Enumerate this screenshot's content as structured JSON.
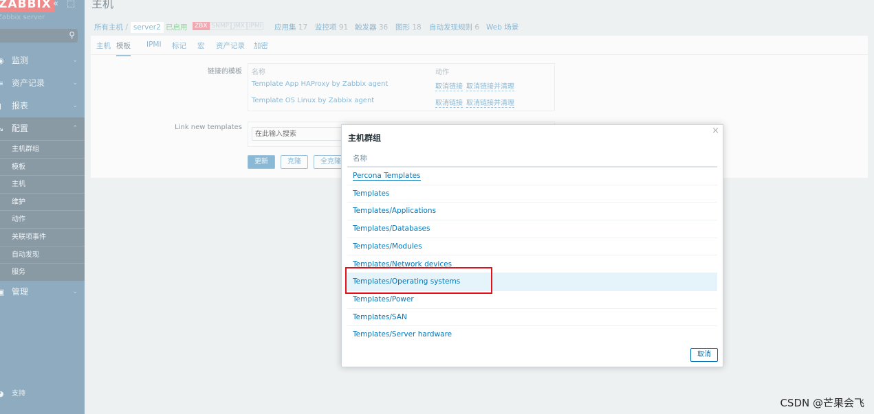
{
  "sidebar": {
    "logo": "ZABBIX",
    "server": "Zabbix server",
    "menu": [
      {
        "label": "监测",
        "icon": "eye-icon"
      },
      {
        "label": "资产记录",
        "icon": "list-icon"
      },
      {
        "label": "报表",
        "icon": "chart-icon"
      },
      {
        "label": "配置",
        "icon": "wrench-icon"
      },
      {
        "label": "管理",
        "icon": "admin-icon"
      }
    ],
    "submenu": [
      "主机群组",
      "模板",
      "主机",
      "维护",
      "动作",
      "关联项事件",
      "自动发现",
      "服务"
    ],
    "support": "支持"
  },
  "header": {
    "title": "主机"
  },
  "nav": {
    "all_hosts": "所有主机",
    "sep": "/",
    "host": "server2",
    "enabled": "已启用",
    "tags": [
      "ZBX",
      "SNMP",
      "JMX",
      "IPMI"
    ],
    "links": [
      {
        "label": "应用集",
        "count": "17"
      },
      {
        "label": "监控项",
        "count": "91"
      },
      {
        "label": "触发器",
        "count": "36"
      },
      {
        "label": "图形",
        "count": "18"
      },
      {
        "label": "自动发现规则",
        "count": "6"
      },
      {
        "label": "Web 场景",
        "count": ""
      }
    ]
  },
  "tabs": [
    "主机",
    "模板",
    "IPMI",
    "标记",
    "宏",
    "资产记录",
    "加密"
  ],
  "form": {
    "linked_label": "链接的模板",
    "col_name": "名称",
    "col_action": "动作",
    "linked": [
      {
        "name": "Template App HAProxy by Zabbix agent",
        "unlink": "取消链接",
        "unlink_clear": "取消链接并清理"
      },
      {
        "name": "Template OS Linux by Zabbix agent",
        "unlink": "取消链接",
        "unlink_clear": "取消链接并清理"
      }
    ],
    "link_new_label": "Link new templates",
    "search_placeholder": "在此输入搜索",
    "buttons": {
      "update": "更新",
      "clone": "克隆",
      "full_clone": "全克隆"
    }
  },
  "dialog": {
    "title": "主机群组",
    "col": "名称",
    "close": "×",
    "cancel": "取消",
    "items": [
      "Percona Templates",
      "Templates",
      "Templates/Applications",
      "Templates/Databases",
      "Templates/Modules",
      "Templates/Network devices",
      "Templates/Operating systems",
      "Templates/Power",
      "Templates/SAN",
      "Templates/Server hardware"
    ],
    "highlighted": "Templates/Operating systems"
  },
  "watermark": "CSDN @芒果会飞"
}
